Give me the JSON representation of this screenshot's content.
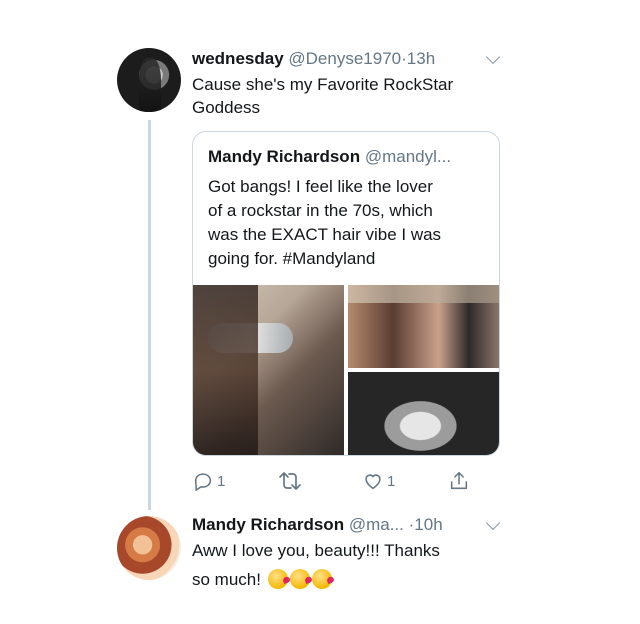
{
  "tweet1": {
    "name": "wednesday",
    "handle": "@Denyse1970",
    "separator": "·",
    "time": "13h",
    "text_line1": "Cause she's my Favorite RockStar",
    "text_line2": "Goddess"
  },
  "quoted": {
    "name": "Mandy Richardson",
    "handle": "@mandyl...",
    "text_line1": "Got bangs! I feel like the lover",
    "text_line2": "of a rockstar in the 70s, which",
    "text_line3": "was the EXACT hair vibe I was",
    "text_line4": "going for. #Mandyland"
  },
  "actions": {
    "reply_count": "1",
    "retweet_count": "",
    "like_count": "1"
  },
  "tweet2": {
    "name": "Mandy Richardson",
    "handle": "@ma...",
    "separator": "·",
    "time": "10h",
    "text_line1": "Aww I love you, beauty!!! Thanks",
    "text_line2": "so much!"
  },
  "colors": {
    "text": "#14171a",
    "muted": "#657786",
    "border": "#ccd6dd"
  }
}
